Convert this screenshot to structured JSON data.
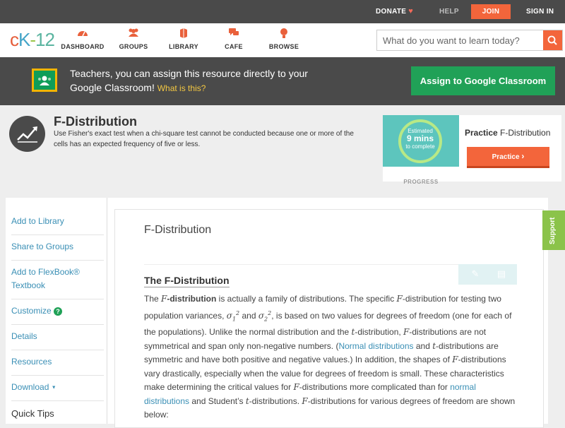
{
  "topbar": {
    "donate": "DONATE",
    "help": "HELP",
    "join": "JOIN",
    "signin": "SIGN IN"
  },
  "logo": {
    "c": "c",
    "k": "K",
    "dash": "-",
    "num": "12"
  },
  "nav": {
    "items": [
      {
        "label": "DASHBOARD",
        "icon": "dashboard-icon"
      },
      {
        "label": "GROUPS",
        "icon": "groups-icon"
      },
      {
        "label": "LIBRARY",
        "icon": "library-icon"
      },
      {
        "label": "CAFE",
        "icon": "cafe-icon"
      },
      {
        "label": "BROWSE",
        "icon": "browse-icon"
      }
    ],
    "search_placeholder": "What do you want to learn today?"
  },
  "teacher_banner": {
    "message": "Teachers, you can assign this resource directly to your Google Classroom!",
    "what_is_this": "What is this?",
    "assign_button": "Assign to Google Classroom"
  },
  "concept": {
    "title": "F-Distribution",
    "description": "Use Fisher's exact test when a chi-square test cannot be conducted because one or more of the cells has an expected frequency of five or less."
  },
  "practice": {
    "estimate_line1": "Estimated",
    "estimate_minutes": "9 mins",
    "estimate_line3": "to complete",
    "progress_label": "PROGRESS",
    "title_bold": "Practice",
    "title_rest": "F-Distribution",
    "button": "Practice"
  },
  "sidebar": {
    "items": [
      "Add to Library",
      "Share to Groups",
      "Add to FlexBook® Textbook",
      "Customize",
      "Details",
      "Resources",
      "Download"
    ],
    "download_caret": "▼",
    "help_mark": "?",
    "quick_tips": "Quick Tips"
  },
  "content": {
    "page_title": "F-Distribution",
    "section_title": "The F-Distribution"
  },
  "support": "Support",
  "colors": {
    "accent_orange": "#f3653b",
    "google_green": "#20a157",
    "link_blue": "#3a8fb5",
    "dark_bar": "#4a4a4a"
  }
}
